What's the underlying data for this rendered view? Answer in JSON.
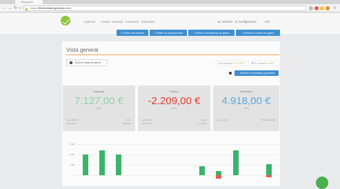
{
  "browser": {
    "tab_title": "Vista general",
    "url_scheme": "https://",
    "url_rest": "tiketsdedaily.getquipu.com"
  },
  "nav": {
    "links": [
      "Ingresos",
      "Gastos",
      "Usuarios",
      "Contactos",
      "Impuestos"
    ],
    "right": [
      "Archivos",
      "Configuración",
      "Info"
    ]
  },
  "actions": [
    "+ Emitir una factura",
    "+ Emitir un presupuesto",
    "+ Añadir una factura de gasto",
    "+ Añadir un ticket de gasto"
  ],
  "overview": {
    "title": "Vista general",
    "year_select": "2014",
    "period_select": "Todo el año",
    "iva_label": "IVA a liquidar",
    "iva_value": "1.127,00 €",
    "irpf_label": "IRPF a liquidar",
    "irpf_value": "0,00 €",
    "history_button": "Histórico de pérdidas y ganancias"
  },
  "cards": [
    {
      "title": "Ingresos",
      "value": "7.127,00 €",
      "sub": "(B&E)",
      "color": "#8fd1a6",
      "foot_left": [
        "Iva 1.458,00 €",
        "IRPF 0,00 €"
      ],
      "foot_right": [
        "TOTAL",
        "8.585,00 €"
      ]
    },
    {
      "title": "Gastos",
      "value": "-2.209,00 €",
      "sub": "(B&E)",
      "color": "#e63b2e",
      "foot_left": [
        "Iva 364,70 €",
        "IRPF 0,00 €"
      ],
      "foot_right": [
        "TOTAL",
        "-2.573,00 €"
      ]
    },
    {
      "title": "Resultado",
      "value": "4.918,00 €",
      "sub": "(B&E)",
      "color": "#5ba8de",
      "foot_left": [
        "Iva 1.127,00 €"
      ],
      "foot_right": [
        "TOTAL 6.045,00 €"
      ]
    }
  ],
  "chart_data": {
    "type": "bar",
    "yticks": [
      "1.500",
      "1.000",
      "500",
      "0"
    ],
    "ylim": [
      0,
      1500
    ],
    "series": [
      {
        "name": "Ingresos",
        "color": "#3bb36a",
        "values": [
          1000,
          1200,
          1000,
          0,
          0,
          0,
          0,
          450,
          200,
          1200,
          0,
          550
        ]
      },
      {
        "name": "Gastos",
        "color": "#e85a4f",
        "values": [
          0,
          0,
          0,
          0,
          0,
          0,
          0,
          0,
          150,
          0,
          0,
          100
        ]
      }
    ]
  },
  "colors": {
    "accent": "#3d8ed2",
    "brand": "#8cc63f",
    "orange": "#f2a154"
  }
}
